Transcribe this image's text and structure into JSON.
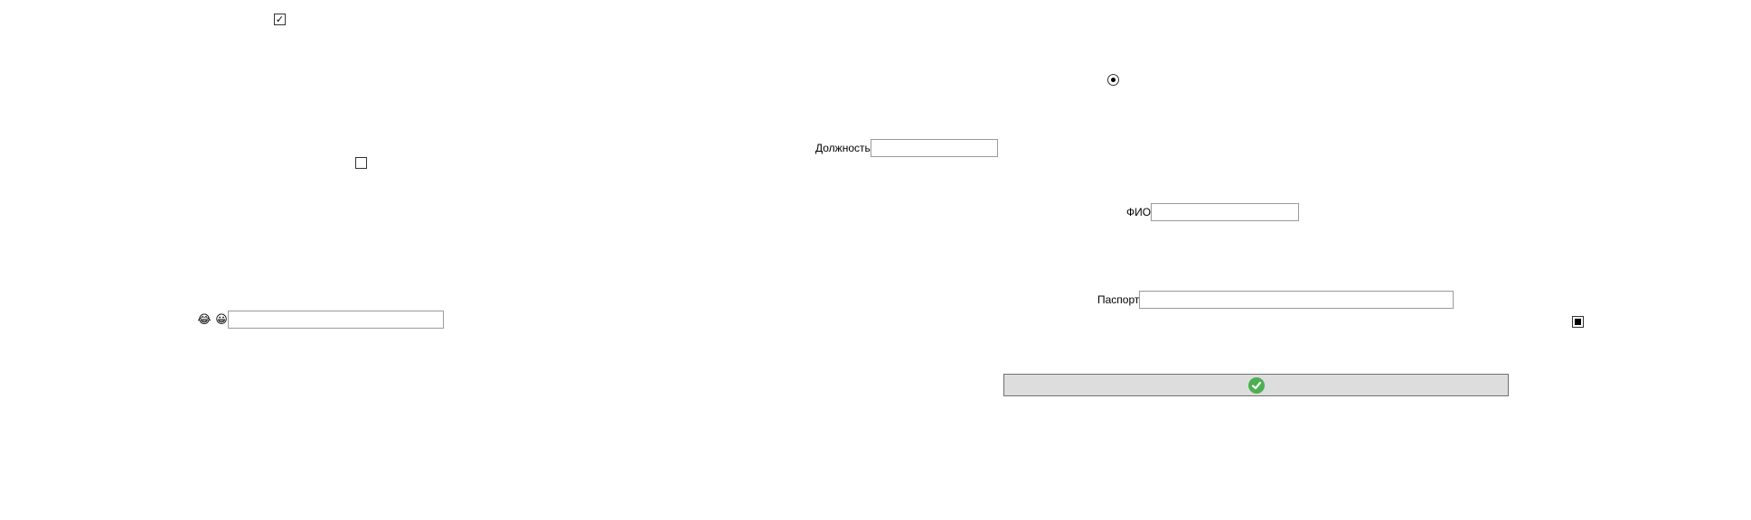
{
  "form": {
    "checkbox_top": {
      "checked": true,
      "glyph": "✓"
    },
    "checkbox_middle": {
      "checked": false
    },
    "radio_top": {
      "selected": true
    },
    "position_field": {
      "label": "Должность",
      "value": "",
      "placeholder": ""
    },
    "name_field": {
      "label": "ФИО",
      "value": "",
      "placeholder": ""
    },
    "passport_field": {
      "label": "Паспорт",
      "value": "",
      "placeholder": ""
    },
    "emoji_field": {
      "icons": [
        "😂",
        "😀"
      ],
      "value": "",
      "placeholder": ""
    },
    "checkbox_right": {
      "state": "indeterminate"
    },
    "submit_button": {
      "icon": "check-circle-icon",
      "accent": "#4caf50"
    }
  },
  "colors": {
    "background": "#ffffff",
    "input_border": "#9a9a9a",
    "button_bg": "#dddddd"
  }
}
